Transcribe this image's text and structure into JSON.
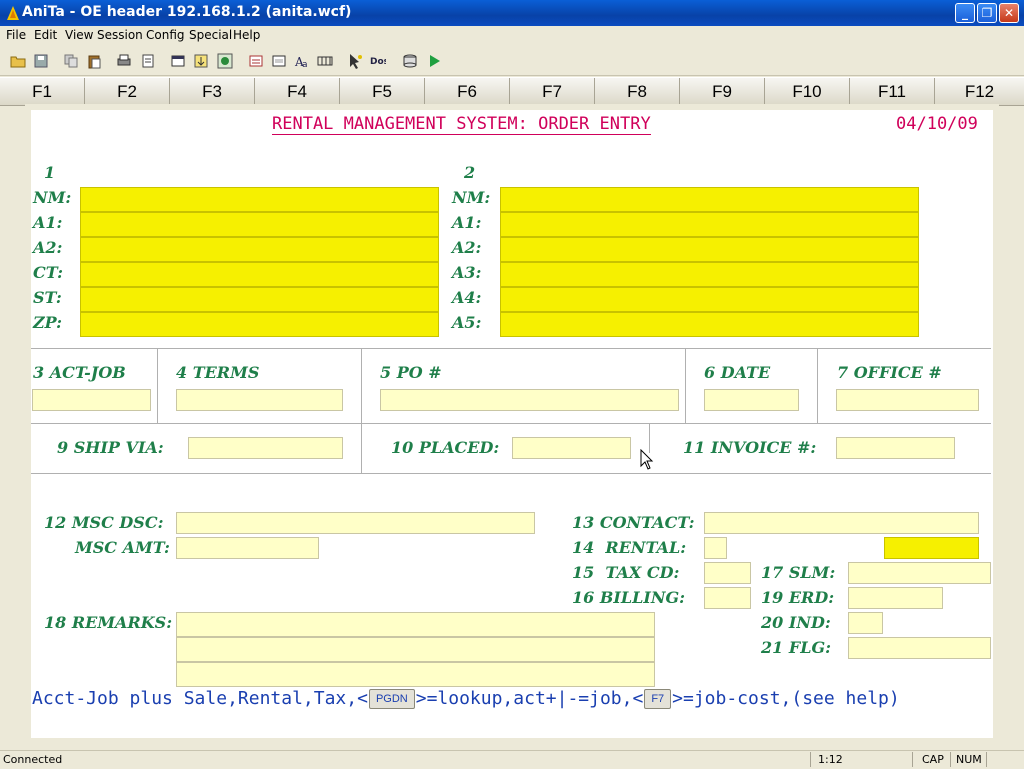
{
  "window": {
    "title": "AniTa - OE header  192.168.1.2 (anita.wcf)"
  },
  "menu": [
    "File",
    "Edit",
    "View",
    "Session",
    "Config",
    "Special",
    "Help"
  ],
  "fkeys": [
    "F1",
    "F2",
    "F3",
    "F4",
    "F5",
    "F6",
    "F7",
    "F8",
    "F9",
    "F10",
    "F11",
    "F12"
  ],
  "header": {
    "title": "RENTAL MANAGEMENT SYSTEM: ORDER ENTRY",
    "date": "04/10/09"
  },
  "address": {
    "col1_num": "1",
    "col2_num": "2",
    "col1_labels": [
      "NM:",
      "A1:",
      "A2:",
      "CT:",
      "ST:",
      "ZP:"
    ],
    "col2_labels": [
      "NM:",
      "A1:",
      "A2:",
      "A3:",
      "A4:",
      "A5:"
    ]
  },
  "fields": {
    "act_job": "3 ACT-JOB",
    "terms": "4 TERMS",
    "po": "5 PO #",
    "date": "6 DATE",
    "office": "7 OFFICE #",
    "ship_via": "9 SHIP VIA:",
    "placed": "10 PLACED:",
    "invoice": "11 INVOICE #:",
    "msc_dsc": "12 MSC DSC:",
    "msc_amt": "MSC AMT:",
    "contact": "13 CONTACT:",
    "rental": "14  RENTAL:",
    "tax_cd": "15  TAX CD:",
    "billing": "16 BILLING:",
    "slm": "17 SLM:",
    "remarks": "18 REMARKS:",
    "erd": "19 ERD:",
    "ind": "20 IND:",
    "flg": "21 FLG:"
  },
  "help": {
    "part1": "Acct-Job plus Sale,Rental,Tax,<",
    "key1": "PGDN",
    "part2": ">=lookup,act+|-=job,<",
    "key2": "F7",
    "part3": ">=job-cost,(see help)"
  },
  "status": {
    "state": "Connected",
    "pos": "1:12",
    "cap": "CAP",
    "num": "NUM"
  }
}
